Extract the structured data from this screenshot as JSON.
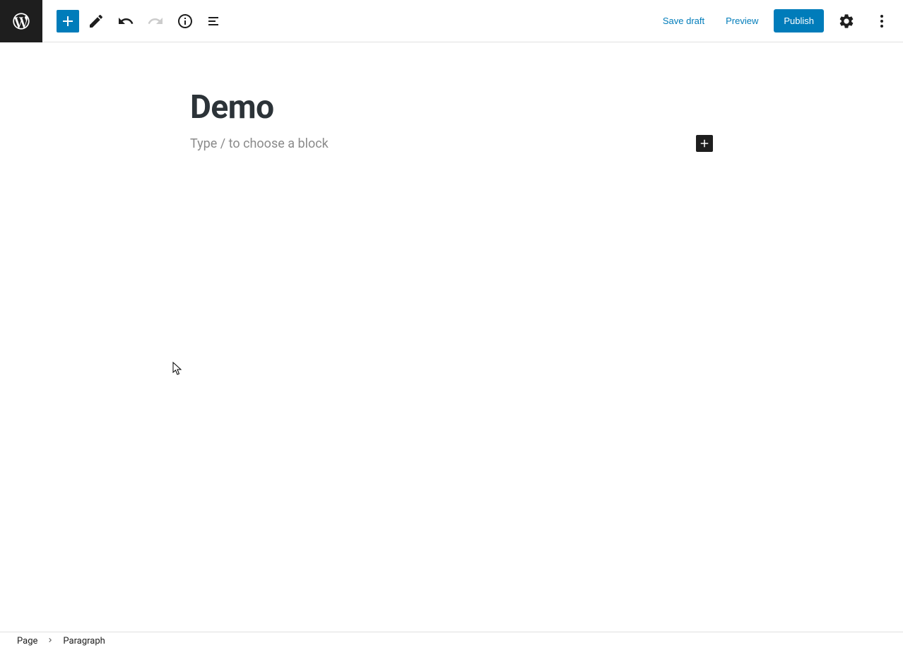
{
  "toolbar": {
    "save_draft": "Save draft",
    "preview": "Preview",
    "publish": "Publish"
  },
  "editor": {
    "title": "Demo",
    "placeholder": "Type / to choose a block"
  },
  "breadcrumb": {
    "root": "Page",
    "current": "Paragraph"
  }
}
